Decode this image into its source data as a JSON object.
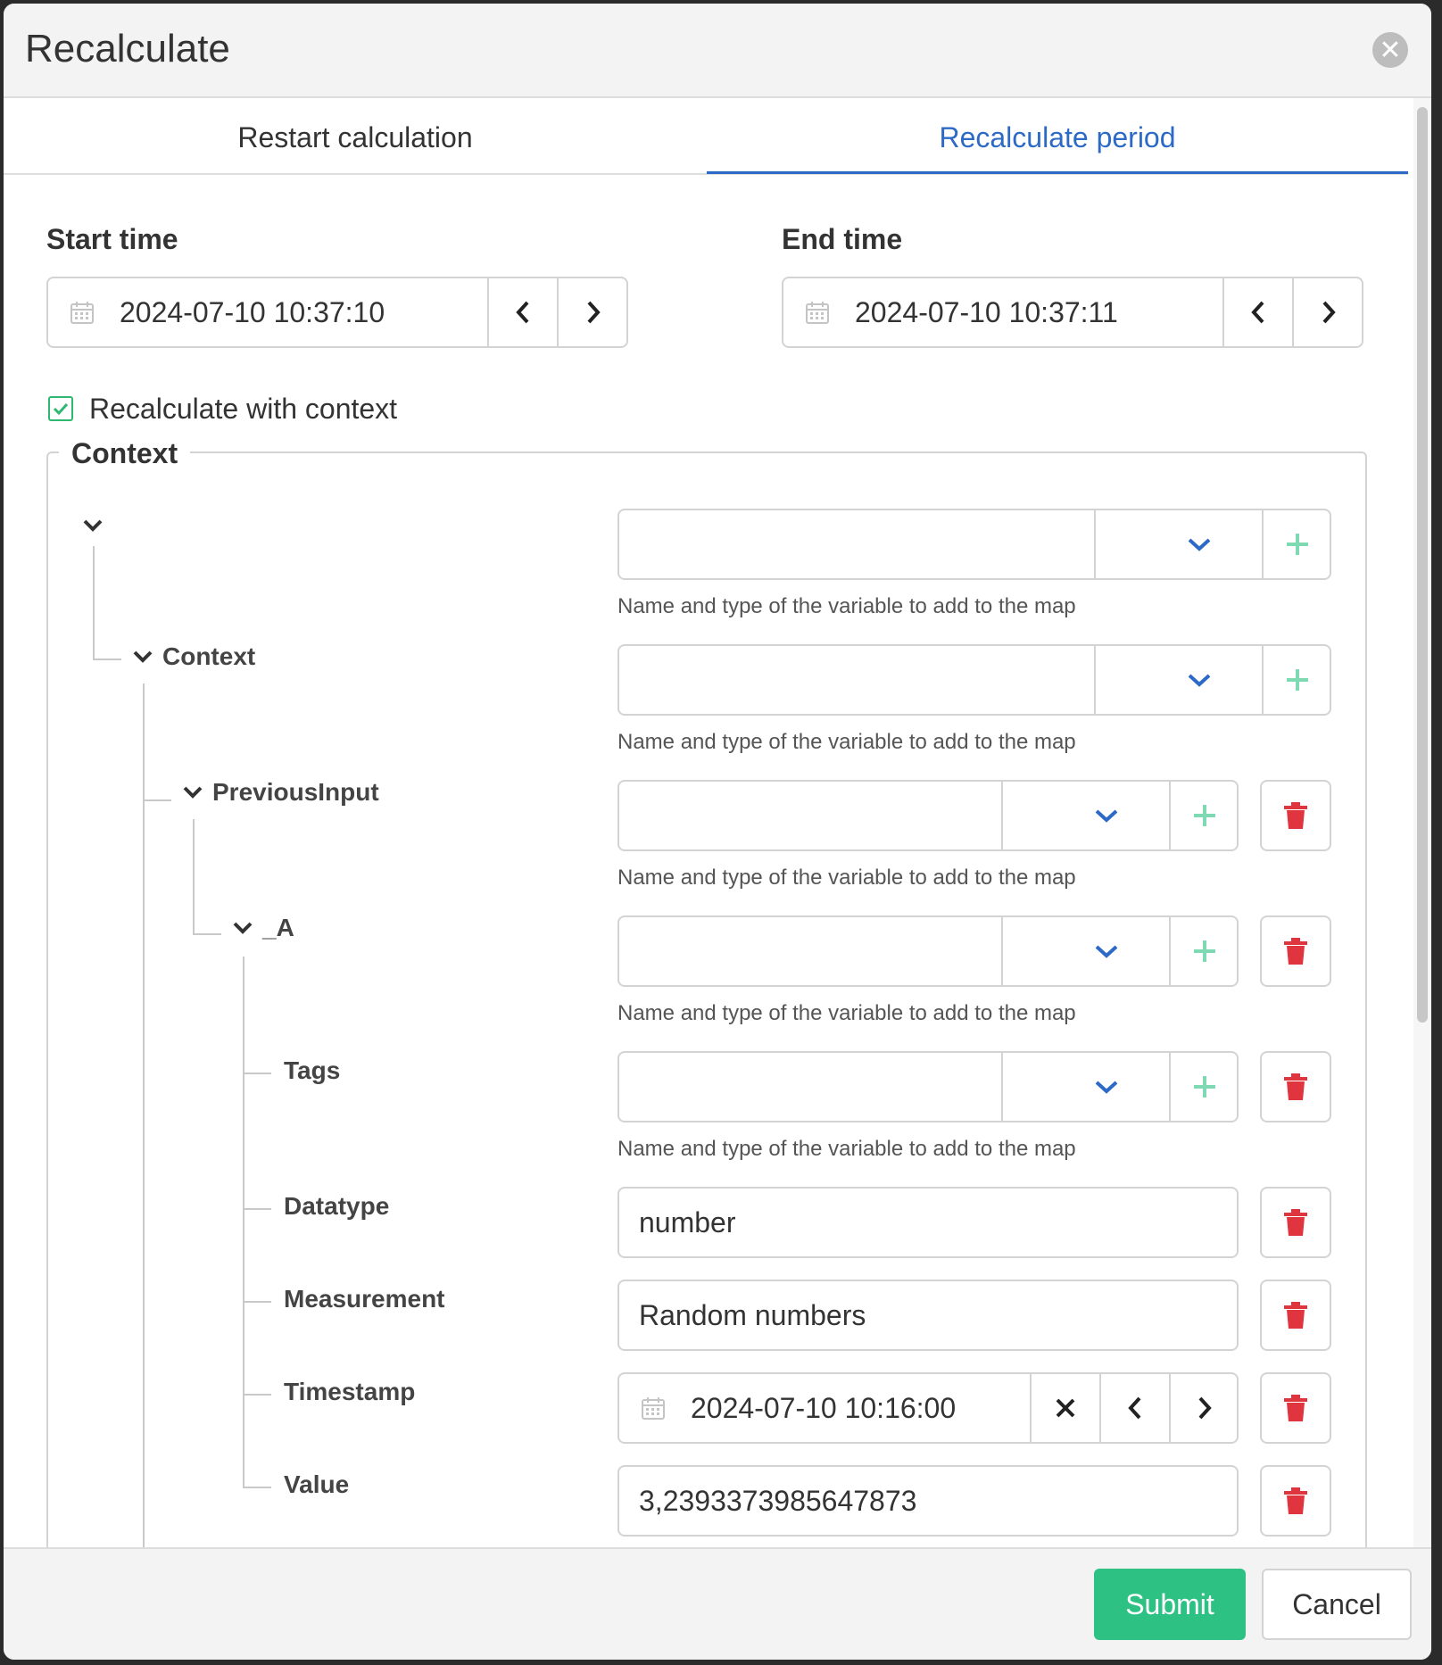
{
  "dialog": {
    "title": "Recalculate"
  },
  "tabs": [
    {
      "label": "Restart calculation",
      "active": false
    },
    {
      "label": "Recalculate period",
      "active": true
    }
  ],
  "start_time": {
    "label": "Start time",
    "value": "2024-07-10 10:37:10"
  },
  "end_time": {
    "label": "End time",
    "value": "2024-07-10 10:37:11"
  },
  "recalc_context": {
    "label": "Recalculate with context",
    "checked": true
  },
  "context": {
    "legend": "Context",
    "tree": {
      "root": "",
      "context": "Context",
      "previous_input": "PreviousInput",
      "a": "_A",
      "tags": "Tags",
      "datatype": "Datatype",
      "measurement": "Measurement",
      "timestamp": "Timestamp",
      "value": "Value"
    },
    "hint": "Name and type of the variable to add to the map",
    "values": {
      "datatype": "number",
      "measurement": "Random numbers",
      "timestamp": "2024-07-10 10:16:00",
      "value": "3,2393373985647873"
    }
  },
  "footer": {
    "submit": "Submit",
    "cancel": "Cancel"
  },
  "colors": {
    "accent": "#2d6ac6",
    "submit": "#2ec184",
    "delete": "#e0343f",
    "add": "#7fd9b3"
  }
}
